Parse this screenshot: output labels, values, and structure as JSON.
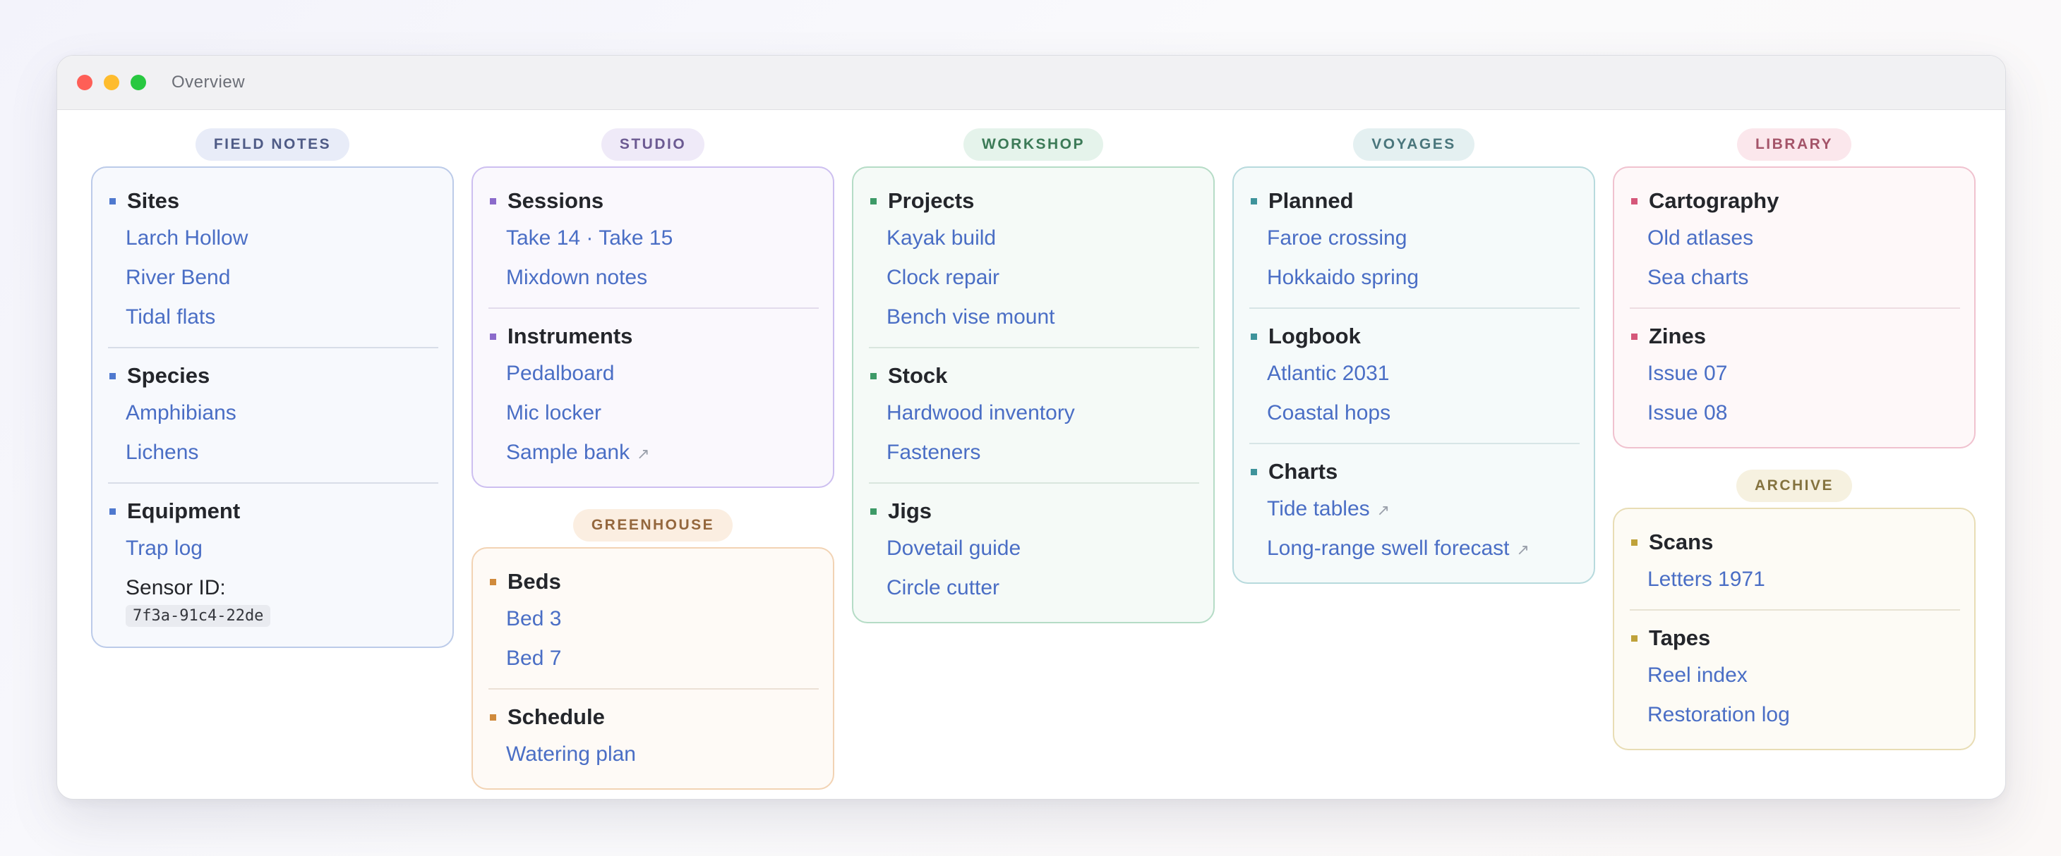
{
  "window": {
    "title": "Overview"
  },
  "sections": {
    "field_notes": {
      "label": "FIELD NOTES",
      "groups": [
        {
          "title": "Sites",
          "links": [
            "Larch Hollow",
            "River Bend",
            "Tidal flats"
          ]
        },
        {
          "title": "Species",
          "links": [
            "Amphibians",
            "Lichens"
          ]
        },
        {
          "title": "Equipment",
          "links": [
            "Trap log"
          ],
          "sensor_label": "Sensor ID:",
          "sensor_id": "7f3a-91c4-22de"
        }
      ]
    },
    "studio": {
      "label": "STUDIO",
      "groups": [
        {
          "title": "Sessions",
          "links": [
            "Take 14 · Take 15",
            "Mixdown notes"
          ]
        },
        {
          "title": "Instruments",
          "links": [
            "Pedalboard",
            "Mic locker",
            "Sample bank"
          ]
        }
      ]
    },
    "greenhouse": {
      "label": "GREENHOUSE",
      "groups": [
        {
          "title": "Beds",
          "links": [
            "Bed 3",
            "Bed 7"
          ]
        },
        {
          "title": "Schedule",
          "links": [
            "Watering plan"
          ]
        }
      ]
    },
    "workshop": {
      "label": "WORKSHOP",
      "groups": [
        {
          "title": "Projects",
          "links": [
            "Kayak build",
            "Clock repair",
            "Bench vise mount"
          ]
        },
        {
          "title": "Stock",
          "links": [
            "Hardwood inventory",
            "Fasteners"
          ]
        },
        {
          "title": "Jigs",
          "links": [
            "Dovetail guide",
            "Circle cutter"
          ]
        }
      ]
    },
    "voyages": {
      "label": "VOYAGES",
      "groups": [
        {
          "title": "Planned",
          "links": [
            "Faroe crossing",
            "Hokkaido spring"
          ]
        },
        {
          "title": "Logbook",
          "links": [
            "Atlantic 2031",
            "Coastal hops"
          ]
        },
        {
          "title": "Charts",
          "links": [
            "Tide tables",
            "Long-range swell forecast"
          ]
        }
      ]
    },
    "library": {
      "label": "LIBRARY",
      "groups": [
        {
          "title": "Cartography",
          "links": [
            "Old atlases",
            "Sea charts"
          ]
        },
        {
          "title": "Zines",
          "links": [
            "Issue 07",
            "Issue 08"
          ]
        }
      ]
    },
    "archive": {
      "label": "ARCHIVE",
      "groups": [
        {
          "title": "Scans",
          "links": [
            "Letters 1971"
          ]
        },
        {
          "title": "Tapes",
          "links": [
            "Reel index",
            "Restoration log"
          ]
        }
      ]
    }
  },
  "external_link_glyph": "↗",
  "icons": {
    "external": "external-link-icon"
  }
}
